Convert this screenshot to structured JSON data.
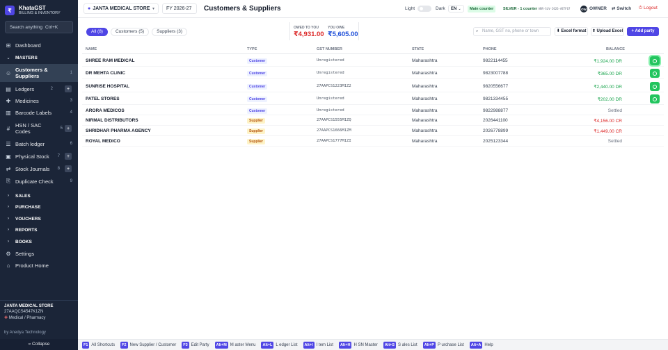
{
  "brand": {
    "name": "KhataGST",
    "subtitle": "BILLING & INVENTORY",
    "logo": "₹"
  },
  "sidebar": {
    "search_placeholder": "Search anything",
    "search_shortcut": "Ctrl+K",
    "items": [
      {
        "label": "Dashboard",
        "icon": "dashboard-icon"
      },
      {
        "label": "MASTERS",
        "section": true
      },
      {
        "label": "Customers & Suppliers",
        "count": "1",
        "active": true
      },
      {
        "label": "Ledgers",
        "count": "2",
        "plus": true
      },
      {
        "label": "Medicines",
        "count": "3"
      },
      {
        "label": "Barcode Labels",
        "count": "4"
      },
      {
        "label": "HSN / SAC Codes",
        "count": "5",
        "plus": true
      },
      {
        "label": "Batch ledger",
        "count": "6"
      },
      {
        "label": "Physical Stock",
        "count": "7",
        "plus": true
      },
      {
        "label": "Stock Journals",
        "count": "8",
        "plus": true
      },
      {
        "label": "Duplicate Check",
        "count": "9"
      }
    ],
    "sections": [
      "SALES",
      "PURCHASE",
      "VOUCHERS",
      "REPORTS",
      "BOOKS"
    ],
    "settings": "Settings",
    "product_home": "Product Home",
    "footer": {
      "company": "JANTA MEDICAL STORE",
      "gstin": "27AAQCS4547K1ZN",
      "type": "Medical / Pharmacy",
      "by": "by Anedya Technology",
      "collapse": "« Collapse"
    }
  },
  "topbar": {
    "company": "JANTA MEDICAL STORE",
    "fy": "FY 2026-27",
    "title": "Customers & Suppliers",
    "light": "Light",
    "dark": "Dark",
    "lang": "EN",
    "main_counter": "Main counter",
    "silver": "SILVER - 1 counter",
    "silver_code": "ANR-SLV-2026-AETF67",
    "avatar": "OW",
    "owner": "OWNER",
    "switch": "Switch",
    "logout": "Logout"
  },
  "toolbar": {
    "tabs": [
      {
        "label": "All (8)",
        "active": true
      },
      {
        "label": "Customers (5)",
        "active": false
      },
      {
        "label": "Suppliers (3)",
        "active": false
      }
    ],
    "owed_label": "OWED TO YOU",
    "owed_value": "₹4,931.00",
    "you_owe_label": "YOU OWE",
    "you_owe_value": "₹5,605.00",
    "search_placeholder": "Name, GST no, phone or town",
    "excel_format": "⬇ Excel format",
    "upload_excel": "⬆ Upload Excel",
    "add_party": "+ Add party"
  },
  "table": {
    "headers": [
      "NAME",
      "TYPE",
      "GST NUMBER",
      "STATE",
      "PHONE",
      "BALANCE"
    ],
    "rows": [
      {
        "name": "SHREE RAM MEDICAL",
        "type": "Customer",
        "gst": "Unregistered",
        "state": "Maharashtra",
        "phone": "9822114455",
        "balance": "₹1,924.00 DR",
        "kind": "dr",
        "wa": true,
        "selected": true
      },
      {
        "name": "DR MEHTA CLINIC",
        "type": "Customer",
        "gst": "Unregistered",
        "state": "Maharashtra",
        "phone": "9823007788",
        "balance": "₹365.00 DR",
        "kind": "dr",
        "wa": true
      },
      {
        "name": "SUNRISE HOSPITAL",
        "type": "Customer",
        "gst": "27AAPCS1223M1Z2",
        "state": "Maharashtra",
        "phone": "9820556677",
        "balance": "₹2,440.00 DR",
        "kind": "dr",
        "wa": true
      },
      {
        "name": "PATEL STORES",
        "type": "Customer",
        "gst": "Unregistered",
        "state": "Maharashtra",
        "phone": "9821334455",
        "balance": "₹202.00 DR",
        "kind": "dr",
        "wa": true
      },
      {
        "name": "ARORA MEDICOS",
        "type": "Customer",
        "gst": "Unregistered",
        "state": "Maharashtra",
        "phone": "9822988877",
        "balance": "Settled",
        "kind": "settled"
      },
      {
        "name": "NIRMAL DISTRIBUTORS",
        "type": "Supplier",
        "gst": "27AAPCS1555M1ZQ",
        "state": "Maharashtra",
        "phone": "2026441100",
        "balance": "₹4,156.00 CR",
        "kind": "cr"
      },
      {
        "name": "SHRIDHAR PHARMA AGENCY",
        "type": "Supplier",
        "gst": "27AAPCS1666M1ZM",
        "state": "Maharashtra",
        "phone": "2026778899",
        "balance": "₹1,449.00 CR",
        "kind": "cr"
      },
      {
        "name": "ROYAL MEDICO",
        "type": "Supplier",
        "gst": "27AAPCS1777M1ZI",
        "state": "Maharashtra",
        "phone": "2025123344",
        "balance": "Settled",
        "kind": "settled"
      }
    ]
  },
  "shortcuts": [
    {
      "key": "F1",
      "label": "All Shortcuts"
    },
    {
      "key": "F2",
      "label": "New Supplier / Customer"
    },
    {
      "key": "F3",
      "label": "Edit Party"
    },
    {
      "key": "Alt+M",
      "label": "M aster Menu"
    },
    {
      "key": "Alt+L",
      "label": "L edger List"
    },
    {
      "key": "Alt+I",
      "label": "I tem List"
    },
    {
      "key": "Alt+H",
      "label": "H SN Master"
    },
    {
      "key": "Alt+S",
      "label": "S ales List"
    },
    {
      "key": "Alt+P",
      "label": "P urchase List"
    },
    {
      "key": "Alt+A",
      "label": "Help"
    }
  ],
  "colors": {
    "accent": "#4f46e5",
    "sidebar": "#1b2538",
    "dr": "#16a34a",
    "cr": "#dc2626",
    "whatsapp": "#22c55e"
  }
}
